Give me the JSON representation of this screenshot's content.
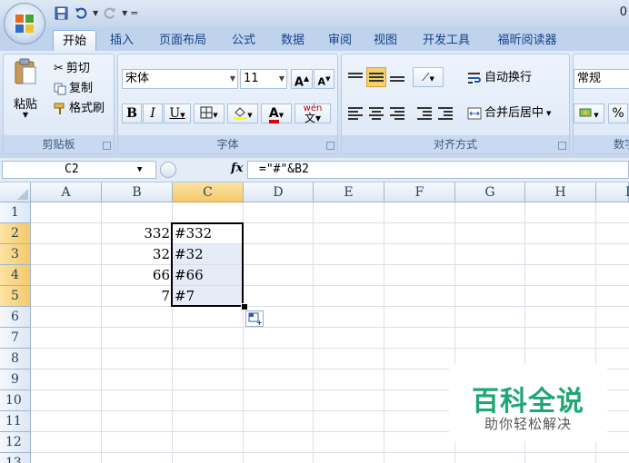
{
  "title": {
    "filename_partial": "0"
  },
  "tabs": [
    "开始",
    "插入",
    "页面布局",
    "公式",
    "数据",
    "审阅",
    "视图",
    "开发工具",
    "福昕阅读器"
  ],
  "clipboard": {
    "paste": "粘贴",
    "cut": "剪切",
    "copy": "复制",
    "format_painter": "格式刷",
    "label": "剪贴板"
  },
  "font": {
    "name": "宋体",
    "size": "11",
    "bold": "B",
    "italic": "I",
    "underline": "U",
    "phonetic": "wén",
    "label": "字体",
    "fill_color": "#ffff00",
    "text_color": "#e00000"
  },
  "alignment": {
    "wrap_text": "自动换行",
    "merge_center": "合并后居中",
    "label": "对齐方式"
  },
  "number": {
    "format": "常规",
    "percent": "%",
    "label": "数字"
  },
  "formula_bar": {
    "cell_ref": "C2",
    "fx": "fx",
    "formula": "=\"#\"&B2"
  },
  "sheet": {
    "columns": [
      "A",
      "B",
      "C",
      "D",
      "E",
      "F",
      "G",
      "H",
      "I"
    ],
    "rows": [
      "1",
      "2",
      "3",
      "4",
      "5",
      "6",
      "7",
      "8",
      "9",
      "10",
      "11",
      "12",
      "13"
    ],
    "active_column": "C",
    "values": [
      {
        "row": 2,
        "b": "332",
        "c": "#332"
      },
      {
        "row": 3,
        "b": "32",
        "c": "#32"
      },
      {
        "row": 4,
        "b": "66",
        "c": "#66"
      },
      {
        "row": 5,
        "b": "7",
        "c": "#7"
      }
    ]
  },
  "watermark": {
    "title": "百科全说",
    "subtitle": "助你轻松解决",
    "color": "#21a675"
  }
}
